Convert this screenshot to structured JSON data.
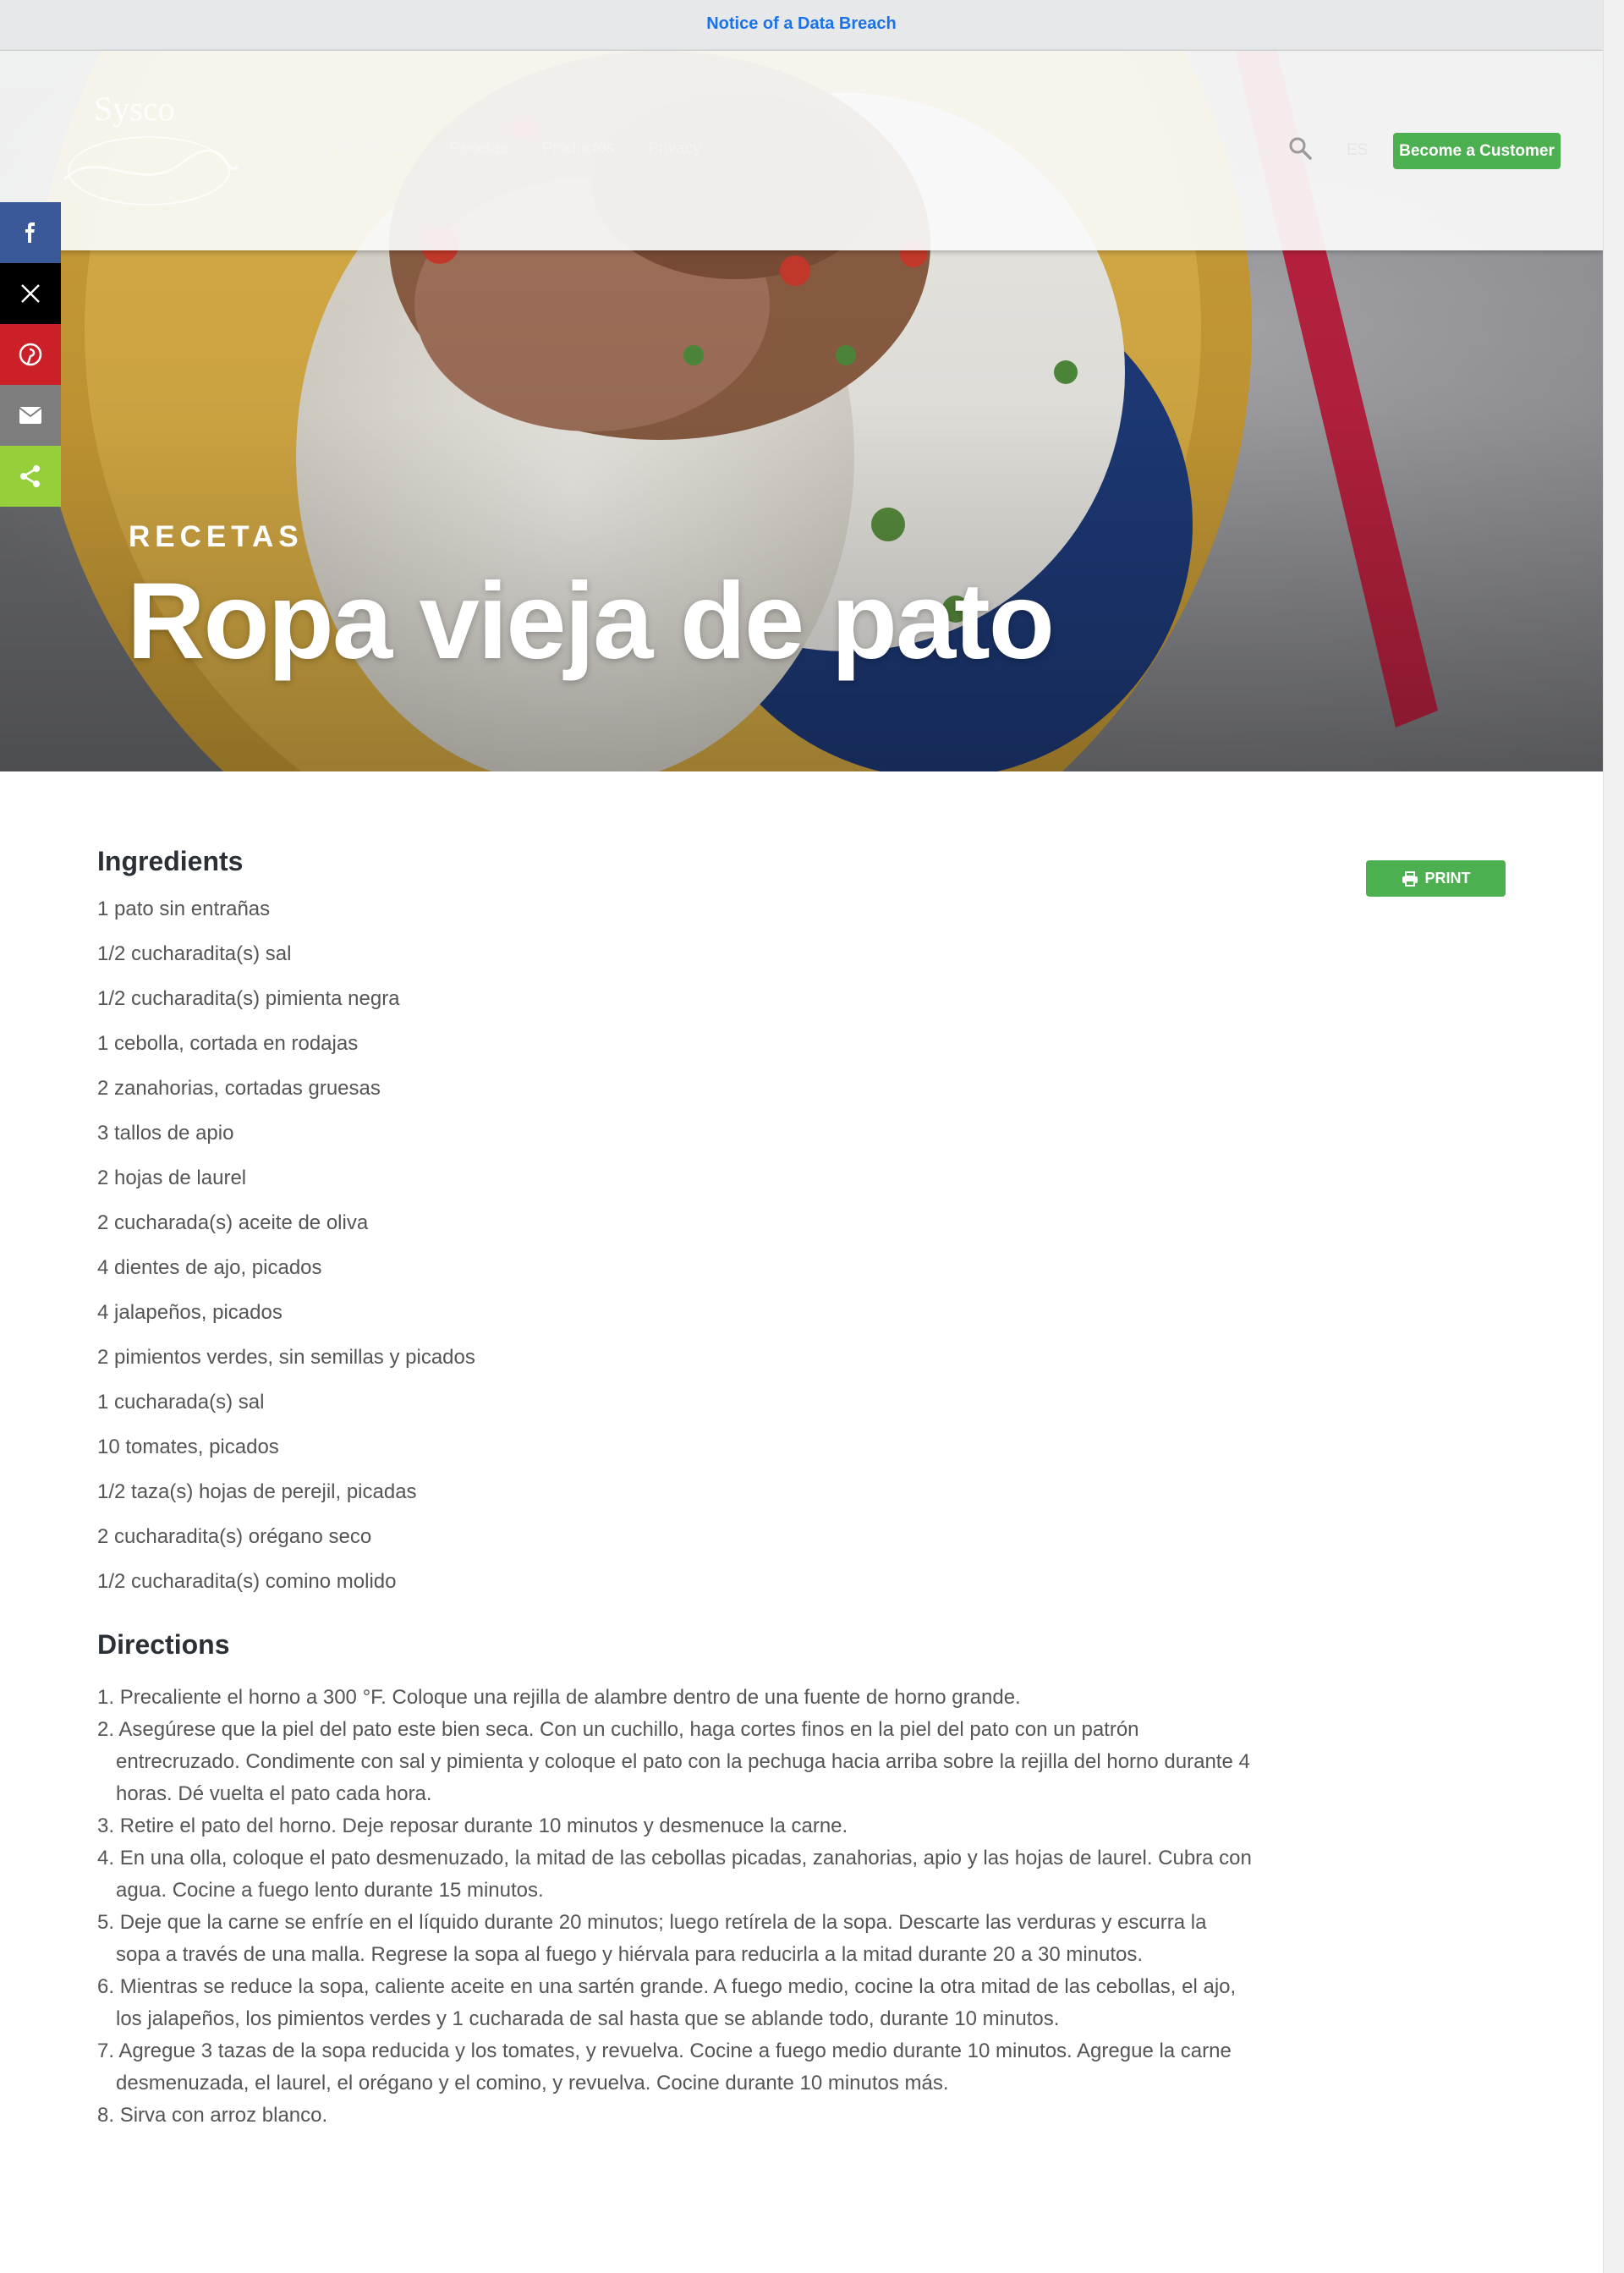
{
  "notice": {
    "text": "Notice of a Data Breach"
  },
  "header": {
    "logo_text": "Sysco",
    "nav": [
      {
        "label": "Tips y Tendencias"
      },
      {
        "label": "Recetas"
      },
      {
        "label": "Productos"
      },
      {
        "label": "Privacy"
      }
    ],
    "language": "ES",
    "cta_label": "Become a Customer"
  },
  "share": [
    {
      "network": "facebook",
      "icon": "facebook-icon"
    },
    {
      "network": "x",
      "icon": "x-icon"
    },
    {
      "network": "pinterest",
      "icon": "pinterest-icon"
    },
    {
      "network": "email",
      "icon": "email-icon"
    },
    {
      "network": "share",
      "icon": "share-icon"
    }
  ],
  "hero": {
    "eyebrow": "RECETAS",
    "title": "Ropa vieja de pato"
  },
  "recipe": {
    "ingredients_title": "Ingredients",
    "print_label": "PRINT",
    "ingredients": [
      "1 pato sin entrañas",
      "1/2 cucharadita(s) sal",
      "1/2 cucharadita(s) pimienta negra",
      "1 cebolla, cortada en rodajas",
      "2 zanahorias, cortadas gruesas",
      "3 tallos de apio",
      "2 hojas de laurel",
      "2 cucharada(s) aceite de oliva",
      "4 dientes de ajo, picados",
      "4 jalapeños, picados",
      "2 pimientos verdes, sin semillas y picados",
      "1 cucharada(s) sal",
      "10 tomates, picados",
      "1/2 taza(s) hojas de perejil, picadas",
      "2 cucharadita(s) orégano seco",
      "1/2 cucharadita(s) comino molido"
    ],
    "directions_title": "Directions",
    "directions": [
      "Precaliente el horno a 300 °F. Coloque una rejilla de alambre dentro de una fuente de horno grande.",
      "Asegúrese que la piel del pato este bien seca. Con un cuchillo, haga cortes finos en la piel del pato con un patrón entrecruzado. Condimente con sal y pimienta y coloque el pato con la pechuga hacia arriba sobre la rejilla del horno durante 4 horas.  Dé vuelta el pato cada hora.",
      "Retire el pato del horno. Deje reposar durante 10 minutos y desmenuce la carne.",
      "En una olla, coloque el pato desmenuzado, la mitad de las cebollas picadas, zanahorias, apio y las hojas de laurel. Cubra con agua. Cocine a fuego lento durante 15 minutos.",
      "Deje que la carne se enfríe en el líquido durante 20 minutos; luego retírela de la sopa. Descarte las verduras y escurra la sopa a través de una malla. Regrese la sopa al fuego y hiérvala para reducirla a la mitad durante 20 a 30 minutos.",
      "Mientras se reduce la sopa, caliente aceite en una sartén grande. A fuego medio, cocine la otra mitad de las cebollas, el ajo, los jalapeños, los pimientos verdes y 1 cucharada de sal hasta que se ablande todo, durante 10 minutos.",
      "Agregue 3 tazas de la sopa reducida y los tomates, y revuelva. Cocine a fuego medio durante 10 minutos. Agregue la carne desmenuzada, el laurel, el orégano y el comino, y revuelva. Cocine durante 10 minutos más.",
      "Sirva con arroz blanco."
    ]
  },
  "colors": {
    "brand_green": "#4caf50",
    "link_blue": "#1a73e8",
    "facebook": "#3b5998",
    "pinterest": "#cb2027",
    "share_green": "#95d03a"
  }
}
